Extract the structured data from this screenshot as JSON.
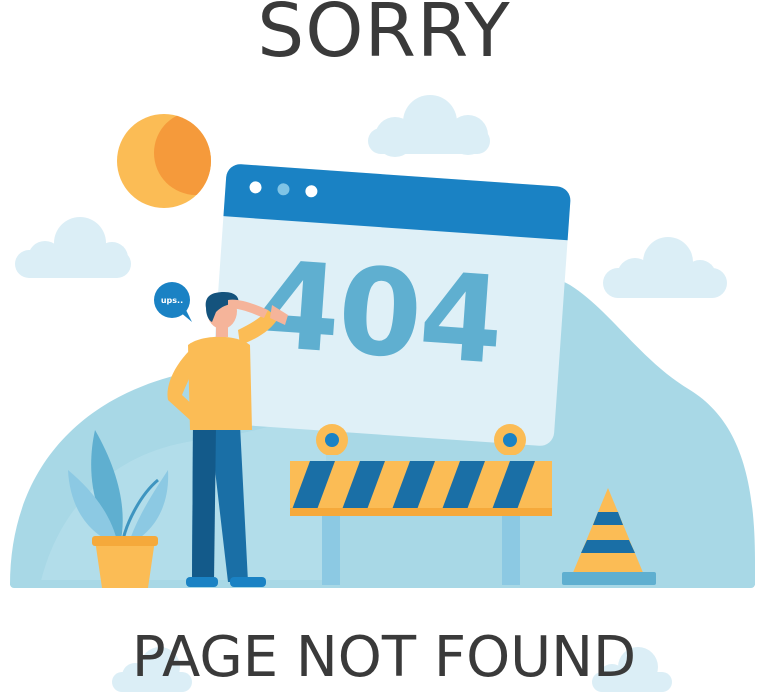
{
  "header": {
    "title": "SORRY"
  },
  "footer": {
    "message": "PAGE NOT FOUND"
  },
  "illustration": {
    "error_code": "404",
    "speech_bubble": "ups..",
    "icons": [
      "sun-icon",
      "cloud-icon",
      "browser-window-icon",
      "person-icon",
      "speech-bubble-icon",
      "barrier-icon",
      "traffic-cone-icon",
      "potted-plant-icon"
    ]
  },
  "colors": {
    "text": "#3a3a3a",
    "hill": "#a8d8e6",
    "window_frame": "#1a82c4",
    "window_body": "#dff0f7",
    "error_code": "#5fafd0",
    "sun": "#fbbc55",
    "stripe_yellow": "#fbbc55",
    "stripe_blue": "#1a6fa6"
  }
}
